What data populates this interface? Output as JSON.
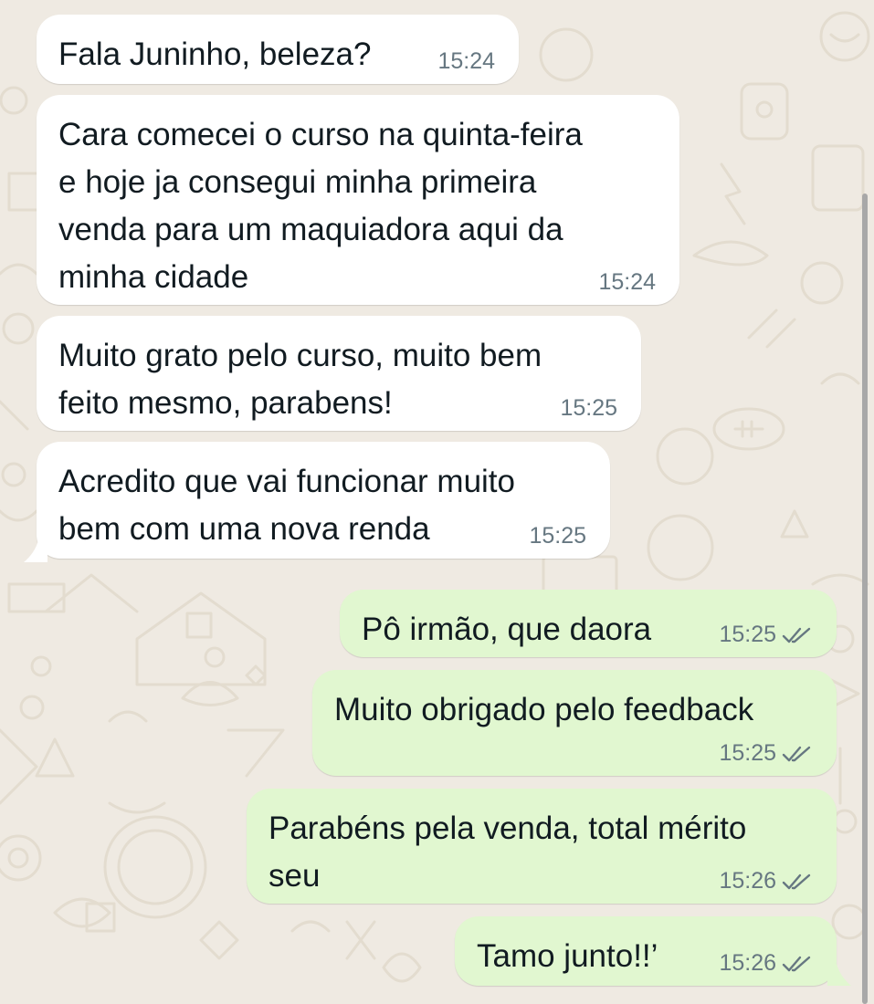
{
  "colors": {
    "background": "#efeae2",
    "incoming_bubble": "#ffffff",
    "outgoing_bubble": "#e1f7d0",
    "text": "#111b21",
    "timestamp": "#667781"
  },
  "messages": [
    {
      "direction": "incoming",
      "text": "Fala Juninho, beleza?",
      "time": "15:24"
    },
    {
      "direction": "incoming",
      "text": "Cara comecei o curso na quinta-feira\ne hoje ja consegui minha primeira\nvenda para um maquiadora aqui da\nminha cidade",
      "time": "15:24"
    },
    {
      "direction": "incoming",
      "text": "Muito grato pelo curso, muito bem\nfeito mesmo, parabens!",
      "time": "15:25"
    },
    {
      "direction": "incoming",
      "text": "Acredito que vai funcionar muito\nbem com uma nova renda",
      "time": "15:25"
    },
    {
      "direction": "outgoing",
      "text": "Pô irmão, que daora",
      "time": "15:25",
      "status_icon": "double-check-icon"
    },
    {
      "direction": "outgoing",
      "text": "Muito obrigado pelo feedback",
      "time": "15:25",
      "status_icon": "double-check-icon"
    },
    {
      "direction": "outgoing",
      "text": "Parabéns pela venda, total mérito\nseu",
      "time": "15:26",
      "status_icon": "double-check-icon"
    },
    {
      "direction": "outgoing",
      "text": "Tamo junto!!’",
      "time": "15:26",
      "status_icon": "double-check-icon"
    }
  ]
}
